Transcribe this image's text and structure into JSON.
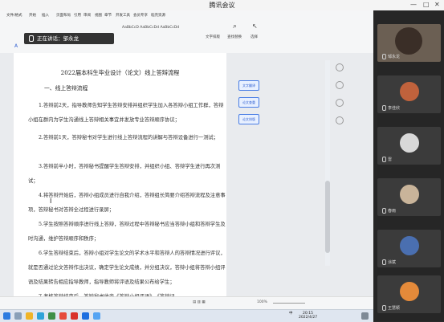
{
  "window": {
    "title": "腾讯会议"
  },
  "ribbon": {
    "tabs": [
      "文件/格式",
      "开始",
      "插入",
      "页面布局",
      "引用",
      "审阅",
      "视图",
      "章节",
      "开发工具",
      "会员专享",
      "稻壳资源"
    ],
    "style_sample": "AaBbCcD AaBbCcDd AaBbCcDd",
    "tools": [
      "文字排版",
      "查找替换",
      "选择"
    ]
  },
  "speaker": {
    "label": "正在讲话：邹永龙"
  },
  "document": {
    "title": "2022届本科生毕业设计（论文）线上答辩流程",
    "heading": "一、线上答辩流程",
    "paragraphs": [
      "1.答辩前2天，指导教师告知学生答辩安排并组织学生加入各答辩小组工作群，答辩小组在群内为学生沟通线上答辩相关事宜并发放专业答辩顺序协议；",
      "2.答辩前1天，答辩秘书对学生进行线上答辩流程的讲解与答辩设备进行一测试；",
      "3.答辩前半小时，答辩秘书提醒学生答辩安排，并组织小组、答辩学生进行再次测试；",
      "4.将答辩开始后，答辩小组成员进行自我介绍，答辩组长简要介绍答辩流程及注意事项，答辩秘书对答辩全过程进行录屏；",
      "5.学生按照答辩顺序进行线上答辩，答辩过程中答辩秘书应当答辩小组和答辩学生及时沟通，维护答辩顺序和秩序；",
      "6.学生答辩结束后，答辩小组对学生论文的学术水平和答辩人的答辩情况进行评议，就是否通过论文答辩作出决议，确定学生论文成绩，并分组决议，答辩小组将答辩小组评语及结果转告相应指导教师，指导教师将评语及结果公布给学生；",
      "7.考核答辩结束后，答辩秘书收齐《答辩小组评语》、《答辩记"
    ]
  },
  "side_buttons": [
    "文字翻译",
    "论文查重",
    "论文排版"
  ],
  "statusbar": {
    "zoom": "100%"
  },
  "taskbar": {
    "time": "20:15",
    "date": "2022/4/27",
    "lang": "中"
  },
  "participants": [
    {
      "name": "邹永龙",
      "color": "#7a6a5a"
    },
    {
      "name": "李佳欣",
      "color": "#c0623c"
    },
    {
      "name": "雷",
      "color": "#d8d8d8"
    },
    {
      "name": "春雨",
      "color": "#c9b49a"
    },
    {
      "name": "涂斌",
      "color": "#4a6fb0"
    },
    {
      "name": "王慧颖",
      "color": "#e48a3a"
    }
  ]
}
